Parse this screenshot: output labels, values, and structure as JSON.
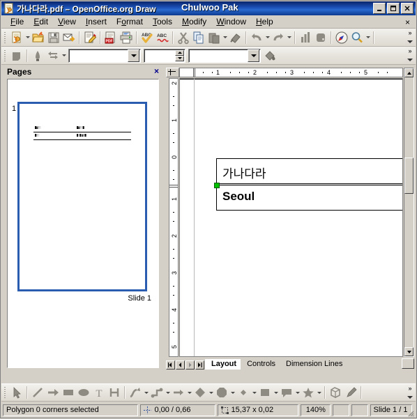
{
  "window": {
    "title": "가나다라.pdf – OpenOffice.org Draw",
    "overlay_text": "Chulwoo Pak",
    "icon": "draw-document-icon",
    "buttons": {
      "minimize": "minimize-button",
      "maximize": "maximize-button",
      "close": "close-button"
    }
  },
  "menubar": {
    "items": [
      {
        "label": "File",
        "accel": "F"
      },
      {
        "label": "Edit",
        "accel": "E"
      },
      {
        "label": "View",
        "accel": "V"
      },
      {
        "label": "Insert",
        "accel": "I"
      },
      {
        "label": "Format",
        "accel": "o"
      },
      {
        "label": "Tools",
        "accel": "T"
      },
      {
        "label": "Modify",
        "accel": "M"
      },
      {
        "label": "Window",
        "accel": "W"
      },
      {
        "label": "Help",
        "accel": "H"
      }
    ],
    "close_document_label": "×"
  },
  "toolbar_standard": {
    "overflow_label": "»",
    "buttons": [
      {
        "name": "new-document-icon",
        "tip": "New"
      },
      {
        "name": "new-document-dropdown-icon",
        "tip": "New dropdown"
      },
      {
        "name": "open-folder-icon",
        "tip": "Open"
      },
      {
        "name": "save-icon",
        "tip": "Save"
      },
      {
        "name": "email-document-icon",
        "tip": "Document as E-mail"
      },
      {
        "name": "edit-file-icon",
        "tip": "Edit File"
      },
      {
        "name": "export-pdf-icon",
        "tip": "Export Directly as PDF"
      },
      {
        "name": "print-icon",
        "tip": "Print File Directly"
      },
      {
        "name": "spelling-check-icon",
        "tip": "Spelling and Grammar"
      },
      {
        "name": "autospellcheck-icon",
        "tip": "AutoSpellcheck"
      },
      {
        "name": "cut-icon",
        "tip": "Cut"
      },
      {
        "name": "copy-icon",
        "tip": "Copy"
      },
      {
        "name": "paste-icon",
        "tip": "Paste"
      },
      {
        "name": "paste-dropdown-icon",
        "tip": "Paste dropdown"
      },
      {
        "name": "clone-formatting-icon",
        "tip": "Clone Formatting"
      },
      {
        "name": "undo-icon",
        "tip": "Undo"
      },
      {
        "name": "undo-dropdown-icon",
        "tip": "Undo dropdown"
      },
      {
        "name": "redo-icon",
        "tip": "Redo"
      },
      {
        "name": "redo-dropdown-icon",
        "tip": "Redo dropdown"
      },
      {
        "name": "chart-icon",
        "tip": "Insert Chart"
      },
      {
        "name": "table-icon",
        "tip": "Insert Table"
      },
      {
        "name": "navigator-icon",
        "tip": "Navigator"
      },
      {
        "name": "zoom-icon",
        "tip": "Zoom"
      },
      {
        "name": "zoom-dropdown-icon",
        "tip": "Zoom dropdown"
      }
    ]
  },
  "toolbar_line_and_filling": {
    "overflow_label": "»",
    "line_style_icon": "line-style-icon",
    "line_endstyle_icon": "arrow-style-icon",
    "line_arrow_icon": "line-arrow-icon",
    "line_style_value": "",
    "line_style_placeholder": "",
    "line_width_value": "",
    "area_style_value": "",
    "fill_icon": "fill-bucket-icon"
  },
  "pages_panel": {
    "title": "Pages",
    "close_label": "×",
    "page_number": "1",
    "slide_label": "Slide 1",
    "thumbnail_rows": [
      {
        "left": "█▓▒░",
        "right": "█▓▒░█"
      },
      {
        "left": "█▒░",
        "right": "█░█ ▓▒█"
      }
    ]
  },
  "editor": {
    "horizontal_ruler_ticks": [
      "1",
      "2",
      "3",
      "4",
      "5"
    ],
    "vertical_ruler_ticks": [
      "2",
      "1",
      "0",
      "1",
      "2",
      "3",
      "4",
      "5"
    ],
    "text_objects": [
      {
        "name": "text-box-korean",
        "text": "가나다라",
        "bold": false
      },
      {
        "name": "text-box-seoul",
        "text": "Seoul",
        "bold": true
      }
    ]
  },
  "layer_tabs": {
    "nav_first": "first-layer-button",
    "nav_prev": "previous-layer-button",
    "nav_next": "next-layer-button",
    "nav_last": "last-layer-button",
    "tabs": [
      {
        "label": "Layout",
        "active": true
      },
      {
        "label": "Controls",
        "active": false
      },
      {
        "label": "Dimension Lines",
        "active": false
      }
    ]
  },
  "toolbar_drawing": {
    "overflow_label": "»",
    "buttons": [
      {
        "name": "select-arrow-icon",
        "tip": "Select"
      },
      {
        "name": "line-icon",
        "tip": "Line"
      },
      {
        "name": "line-ends-with-arrow-icon",
        "tip": "Line Ends with Arrow"
      },
      {
        "name": "rectangle-icon",
        "tip": "Rectangle"
      },
      {
        "name": "ellipse-icon",
        "tip": "Ellipse"
      },
      {
        "name": "text-icon",
        "tip": "Text"
      },
      {
        "name": "dimension-line-icon",
        "tip": "Dimension Line"
      },
      {
        "name": "curve-icon",
        "tip": "Curve"
      },
      {
        "name": "curve-dropdown-icon",
        "tip": "Curve dropdown"
      },
      {
        "name": "connector-icon",
        "tip": "Connector"
      },
      {
        "name": "connector-dropdown-icon",
        "tip": "Connector dropdown"
      },
      {
        "name": "lines-and-arrows-icon",
        "tip": "Lines and Arrows"
      },
      {
        "name": "lines-and-arrows-dropdown-icon",
        "tip": "Lines and Arrows dropdown"
      },
      {
        "name": "basic-shapes-icon",
        "tip": "Basic Shapes"
      },
      {
        "name": "basic-shapes-dropdown-icon",
        "tip": "Basic Shapes dropdown"
      },
      {
        "name": "symbol-shapes-icon",
        "tip": "Symbol Shapes"
      },
      {
        "name": "symbol-shapes-dropdown-icon",
        "tip": "Symbol Shapes dropdown"
      },
      {
        "name": "block-arrows-icon",
        "tip": "Block Arrows"
      },
      {
        "name": "block-arrows-dropdown-icon",
        "tip": "Block Arrows dropdown"
      },
      {
        "name": "flowchart-icon",
        "tip": "Flowchart"
      },
      {
        "name": "flowchart-dropdown-icon",
        "tip": "Flowchart dropdown"
      },
      {
        "name": "callouts-icon",
        "tip": "Callouts"
      },
      {
        "name": "callouts-dropdown-icon",
        "tip": "Callouts dropdown"
      },
      {
        "name": "stars-icon",
        "tip": "Stars"
      },
      {
        "name": "stars-dropdown-icon",
        "tip": "Stars dropdown"
      },
      {
        "name": "3d-objects-icon",
        "tip": "3D Objects"
      },
      {
        "name": "points-icon",
        "tip": "Edit Points"
      }
    ]
  },
  "statusbar": {
    "selection_info": "Polygon 0 corners selected",
    "cursor_position": "0,00 / 0,66",
    "object_size": "15,37 x 0,02",
    "zoom_level": "140%",
    "slide_info": "Slide 1 / 1",
    "position_icon": "position-icon",
    "size-icon": "size-icon"
  },
  "colors": {
    "title_bar_start": "#0a246a",
    "title_bar_end": "#2a6ad0",
    "face": "#d4d0c8",
    "selection_handle": "#00c000",
    "thumb_border": "#2a5db0",
    "panel_close": "#00008b"
  }
}
